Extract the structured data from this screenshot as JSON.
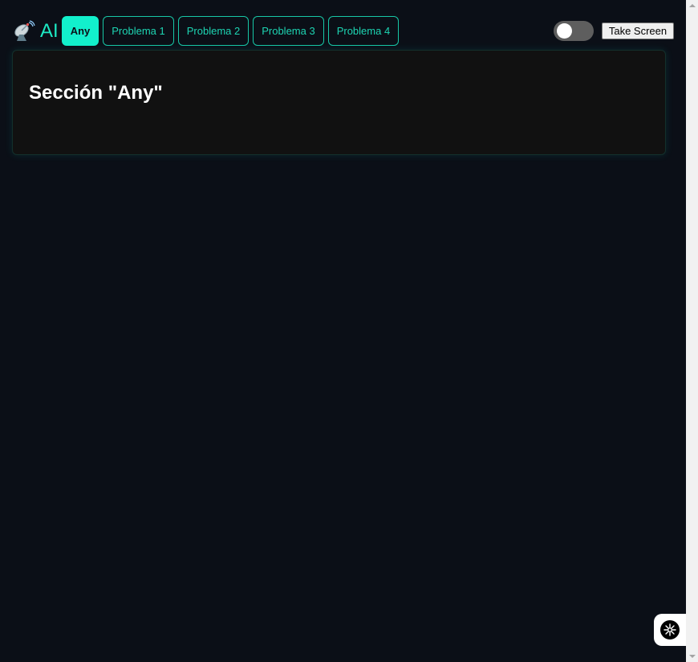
{
  "brand": {
    "icon": "satellite-dish-icon",
    "label": "AI"
  },
  "tabs": [
    {
      "label": "Any",
      "active": true
    },
    {
      "label": "Problema 1",
      "active": false
    },
    {
      "label": "Problema 2",
      "active": false
    },
    {
      "label": "Problema 3",
      "active": false
    },
    {
      "label": "Problema 4",
      "active": false
    }
  ],
  "controls": {
    "theme_toggle": {
      "on": false
    },
    "screenshot_label": "Take Screen"
  },
  "section": {
    "title": "Sección \"Any\""
  },
  "colors": {
    "background": "#0b0f17",
    "accent": "#12f0cc",
    "panel": "#111111"
  }
}
